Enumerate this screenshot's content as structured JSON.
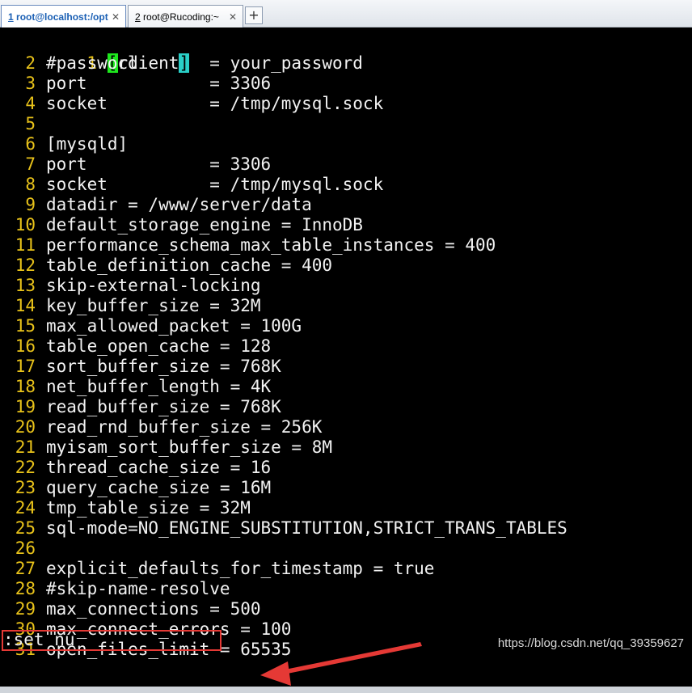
{
  "tabs": [
    {
      "num": "1",
      "label": " root@localhost:/opt",
      "close": "✕",
      "active": true
    },
    {
      "num": "2",
      "label": " root@Rucoding:~",
      "close": "✕",
      "active": false
    }
  ],
  "tab_add": "+",
  "lines": [
    {
      "n": "1",
      "text": "client"
    },
    {
      "n": "2",
      "text": "#password       = your_password"
    },
    {
      "n": "3",
      "text": "port            = 3306"
    },
    {
      "n": "4",
      "text": "socket          = /tmp/mysql.sock"
    },
    {
      "n": "5",
      "text": ""
    },
    {
      "n": "6",
      "text": "[mysqld]"
    },
    {
      "n": "7",
      "text": "port            = 3306"
    },
    {
      "n": "8",
      "text": "socket          = /tmp/mysql.sock"
    },
    {
      "n": "9",
      "text": "datadir = /www/server/data"
    },
    {
      "n": "10",
      "text": "default_storage_engine = InnoDB"
    },
    {
      "n": "11",
      "text": "performance_schema_max_table_instances = 400"
    },
    {
      "n": "12",
      "text": "table_definition_cache = 400"
    },
    {
      "n": "13",
      "text": "skip-external-locking"
    },
    {
      "n": "14",
      "text": "key_buffer_size = 32M"
    },
    {
      "n": "15",
      "text": "max_allowed_packet = 100G"
    },
    {
      "n": "16",
      "text": "table_open_cache = 128"
    },
    {
      "n": "17",
      "text": "sort_buffer_size = 768K"
    },
    {
      "n": "18",
      "text": "net_buffer_length = 4K"
    },
    {
      "n": "19",
      "text": "read_buffer_size = 768K"
    },
    {
      "n": "20",
      "text": "read_rnd_buffer_size = 256K"
    },
    {
      "n": "21",
      "text": "myisam_sort_buffer_size = 8M"
    },
    {
      "n": "22",
      "text": "thread_cache_size = 16"
    },
    {
      "n": "23",
      "text": "query_cache_size = 16M"
    },
    {
      "n": "24",
      "text": "tmp_table_size = 32M"
    },
    {
      "n": "25",
      "text": "sql-mode=NO_ENGINE_SUBSTITUTION,STRICT_TRANS_TABLES"
    },
    {
      "n": "26",
      "text": ""
    },
    {
      "n": "27",
      "text": "explicit_defaults_for_timestamp = true"
    },
    {
      "n": "28",
      "text": "#skip-name-resolve"
    },
    {
      "n": "29",
      "text": "max_connections = 500"
    },
    {
      "n": "30",
      "text": "max_connect_errors = 100"
    },
    {
      "n": "31",
      "text": "open_files_limit = 65535"
    }
  ],
  "bracket_open": "[",
  "bracket_close": "]",
  "command": ":set nu",
  "watermark": "https://blog.csdn.net/qq_39359627",
  "colors": {
    "line_number": "#e8c21a",
    "annotation": "#e53935",
    "bracket_match_open": "#1ee81e",
    "bracket_match_close": "#2ad0c8"
  }
}
